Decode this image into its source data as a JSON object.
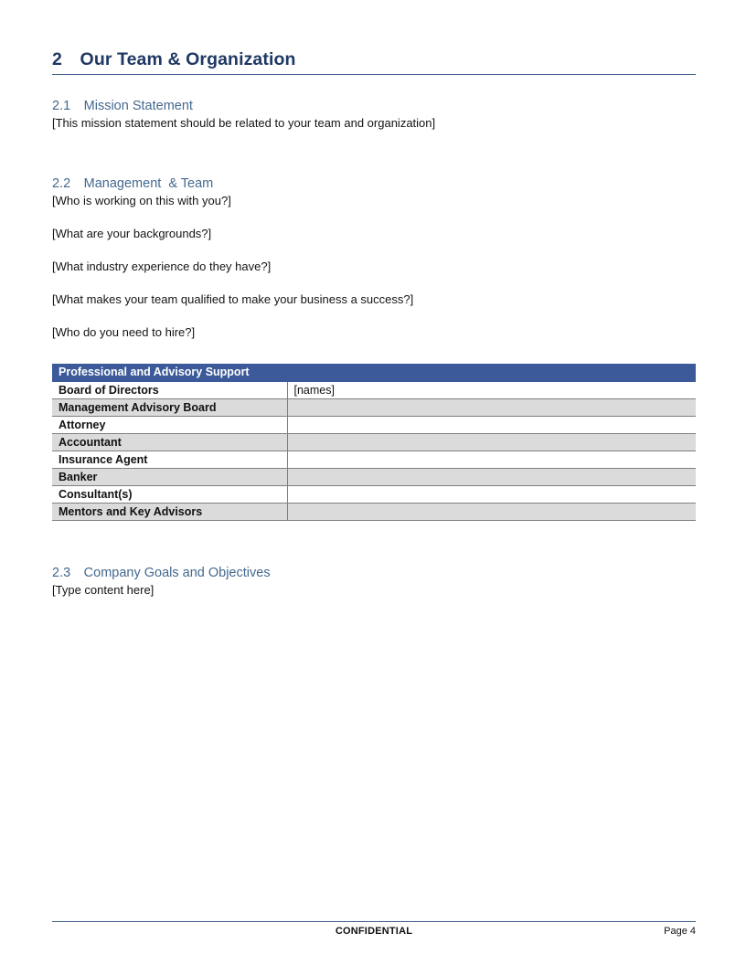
{
  "document": {
    "page_number_label": "Page 4"
  },
  "section": {
    "number": "2",
    "title": "Our Team & Organization",
    "heading_full": "2 Our Team & Organization"
  },
  "subsections": {
    "mission": {
      "heading": "2.1 Mission Statement",
      "number": "2.1",
      "title": "Mission Statement",
      "body": "[This mission statement should be related to your team and organization]"
    },
    "management": {
      "heading": "2.2 Management  & Team",
      "number": "2.2",
      "title": "Management  & Team",
      "prompts": [
        "[Who is working on this with you?]",
        "[What are your backgrounds?]",
        "[What industry experience do they have?]",
        "[What makes your team qualified to make your business a success?]",
        "[Who do you need to hire?]"
      ]
    },
    "goals": {
      "heading": "2.3 Company Goals and Objectives",
      "number": "2.3",
      "title": "Company Goals and Objectives",
      "body": "[Type content here]"
    }
  },
  "support_table": {
    "header": "Professional and Advisory Support",
    "rows": [
      {
        "label": "Board of Directors",
        "value": "[names]"
      },
      {
        "label": "Management Advisory Board",
        "value": ""
      },
      {
        "label": "Attorney",
        "value": ""
      },
      {
        "label": "Accountant",
        "value": ""
      },
      {
        "label": "Insurance Agent",
        "value": ""
      },
      {
        "label": "Banker",
        "value": ""
      },
      {
        "label": "Consultant(s)",
        "value": ""
      },
      {
        "label": "Mentors and Key Advisors",
        "value": ""
      }
    ]
  },
  "footer": {
    "confidential": "CONFIDENTIAL",
    "page": "Page 4"
  },
  "colors": {
    "heading1": "#1F3864",
    "heading2": "#44698F",
    "rule": "#41618E",
    "table_header_bg": "#3C5A99",
    "table_shade": "#DBDBDB",
    "table_border": "#7F7F7F",
    "body_text": "#141414"
  }
}
